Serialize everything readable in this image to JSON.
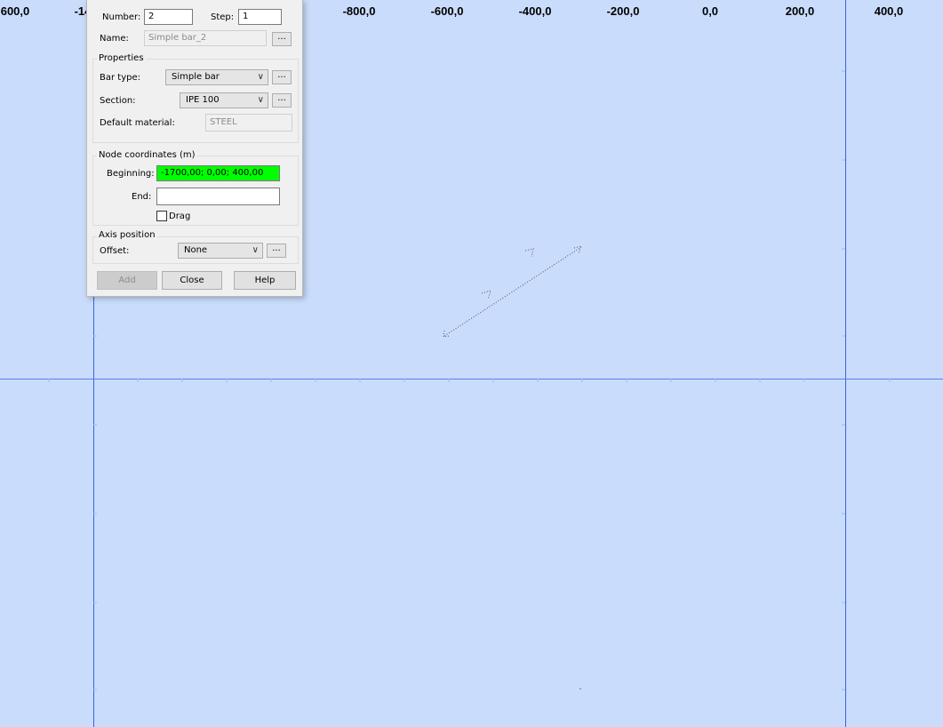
{
  "ruler": {
    "labels": [
      "600,0",
      "-14",
      "-800,0",
      "-600,0",
      "-400,0",
      "-200,0",
      "0,0",
      "200,0",
      "400,0"
    ]
  },
  "colors": {
    "canvas_bg": "#c9dcfb",
    "axis_line": "#3a64d8",
    "beginning_field_bg": "#00ff00"
  },
  "dialog": {
    "number_label": "Number:",
    "number_value": "2",
    "step_label": "Step:",
    "step_value": "1",
    "name_label": "Name:",
    "name_value": "Simple bar_2",
    "ellipsis": "...",
    "properties": {
      "title": "Properties",
      "bar_type_label": "Bar type:",
      "bar_type_value": "Simple bar",
      "section_label": "Section:",
      "section_value": "IPE 100",
      "default_material_label": "Default material:",
      "default_material_value": "STEEL"
    },
    "node_coordinates": {
      "title": "Node coordinates (m)",
      "beginning_label": "Beginning:",
      "beginning_value": "-1700,00; 0,00; 400,00",
      "end_label": "End:",
      "end_value": "",
      "drag_label": "Drag",
      "drag_checked": false
    },
    "axis_position": {
      "title": "Axis position",
      "offset_label": "Offset:",
      "offset_value": "None"
    },
    "buttons": {
      "add": "Add",
      "close": "Close",
      "help": "Help"
    }
  }
}
